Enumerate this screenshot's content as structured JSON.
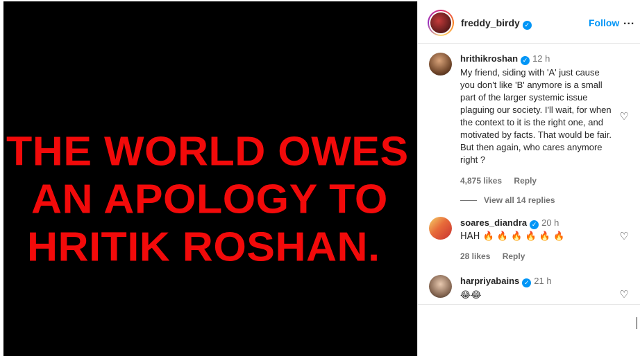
{
  "post": {
    "headline": [
      "THE WORLD OWES",
      "AN APOLOGY TO",
      "HRITIK ROSHAN."
    ],
    "colors": {
      "background": "#000000",
      "headline": "#f20a0a"
    }
  },
  "header": {
    "username": "freddy_birdy",
    "verified": true,
    "follow_label": "Follow",
    "more_label": "..."
  },
  "comments": [
    {
      "username": "hrithikroshan",
      "verified": true,
      "time": "12 h",
      "text": "My friend, siding with 'A' just cause you don't like 'B' anymore is a small part of the larger systemic issue plaguing our society. I'll wait, for when the context to it is the right one, and motivated by facts. That would be fair. But then again, who cares anymore right ?",
      "likes": "4,875 likes",
      "reply_label": "Reply"
    },
    {
      "username": "soares_diandra",
      "verified": true,
      "time": "20 h",
      "text": "HAH 🔥 🔥 🔥 🔥 🔥 🔥",
      "likes": "28 likes",
      "reply_label": "Reply"
    },
    {
      "username": "harpriyabains",
      "verified": true,
      "time": "21 h",
      "text": "😂😂"
    }
  ],
  "view_replies": "View all 14 replies",
  "icons": {
    "verified": "verified-badge-icon",
    "like": "heart-outline-icon"
  },
  "accent_color": "#0095f6"
}
